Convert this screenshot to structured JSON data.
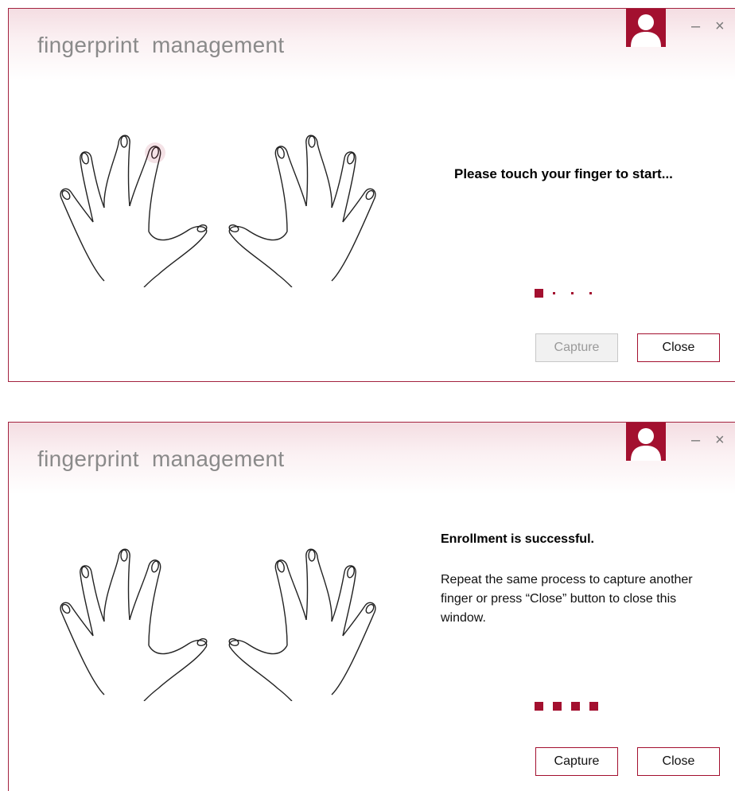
{
  "windows": [
    {
      "title": "fingerprint  management",
      "message_bold": "Please touch your finger to start...",
      "message_text": "",
      "progress": {
        "filled": 1,
        "total": 4
      },
      "capture_label": "Capture",
      "capture_enabled": false,
      "close_label": "Close"
    },
    {
      "title": "fingerprint  management",
      "message_bold": "Enrollment is successful.",
      "message_text": "Repeat the same process to capture another finger or press “Close” button to close this window.",
      "progress": {
        "filled": 4,
        "total": 4
      },
      "capture_label": "Capture",
      "capture_enabled": true,
      "close_label": "Close"
    }
  ],
  "controls": {
    "minimize_glyph": "–",
    "close_glyph": "×"
  },
  "icons": {
    "avatar": "user-avatar-icon",
    "hands": "hands-outline-icon",
    "finger_highlight": "finger-highlight-icon"
  },
  "colors": {
    "accent": "#a3102f",
    "title_gray": "#8a8a8a",
    "disabled_bg": "#f1f1f1"
  }
}
